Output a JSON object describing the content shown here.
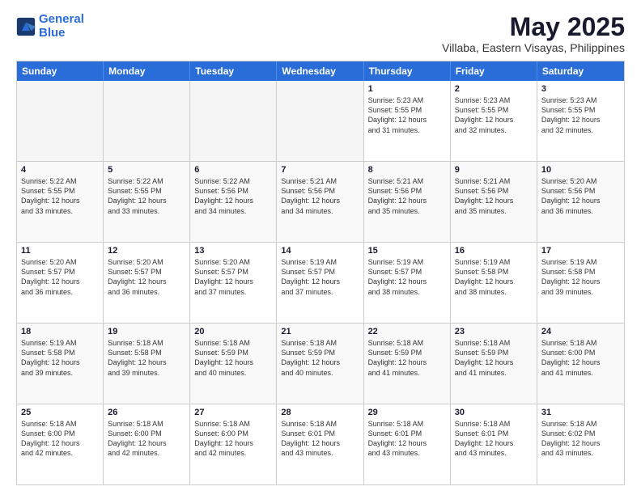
{
  "header": {
    "logo_line1": "General",
    "logo_line2": "Blue",
    "title": "May 2025",
    "subtitle": "Villaba, Eastern Visayas, Philippines"
  },
  "calendar": {
    "days_of_week": [
      "Sunday",
      "Monday",
      "Tuesday",
      "Wednesday",
      "Thursday",
      "Friday",
      "Saturday"
    ],
    "rows": [
      [
        {
          "day": "",
          "text": "",
          "empty": true
        },
        {
          "day": "",
          "text": "",
          "empty": true
        },
        {
          "day": "",
          "text": "",
          "empty": true
        },
        {
          "day": "",
          "text": "",
          "empty": true
        },
        {
          "day": "1",
          "text": "Sunrise: 5:23 AM\nSunset: 5:55 PM\nDaylight: 12 hours\nand 31 minutes.",
          "empty": false
        },
        {
          "day": "2",
          "text": "Sunrise: 5:23 AM\nSunset: 5:55 PM\nDaylight: 12 hours\nand 32 minutes.",
          "empty": false
        },
        {
          "day": "3",
          "text": "Sunrise: 5:23 AM\nSunset: 5:55 PM\nDaylight: 12 hours\nand 32 minutes.",
          "empty": false
        }
      ],
      [
        {
          "day": "4",
          "text": "Sunrise: 5:22 AM\nSunset: 5:55 PM\nDaylight: 12 hours\nand 33 minutes.",
          "empty": false
        },
        {
          "day": "5",
          "text": "Sunrise: 5:22 AM\nSunset: 5:55 PM\nDaylight: 12 hours\nand 33 minutes.",
          "empty": false
        },
        {
          "day": "6",
          "text": "Sunrise: 5:22 AM\nSunset: 5:56 PM\nDaylight: 12 hours\nand 34 minutes.",
          "empty": false
        },
        {
          "day": "7",
          "text": "Sunrise: 5:21 AM\nSunset: 5:56 PM\nDaylight: 12 hours\nand 34 minutes.",
          "empty": false
        },
        {
          "day": "8",
          "text": "Sunrise: 5:21 AM\nSunset: 5:56 PM\nDaylight: 12 hours\nand 35 minutes.",
          "empty": false
        },
        {
          "day": "9",
          "text": "Sunrise: 5:21 AM\nSunset: 5:56 PM\nDaylight: 12 hours\nand 35 minutes.",
          "empty": false
        },
        {
          "day": "10",
          "text": "Sunrise: 5:20 AM\nSunset: 5:56 PM\nDaylight: 12 hours\nand 36 minutes.",
          "empty": false
        }
      ],
      [
        {
          "day": "11",
          "text": "Sunrise: 5:20 AM\nSunset: 5:57 PM\nDaylight: 12 hours\nand 36 minutes.",
          "empty": false
        },
        {
          "day": "12",
          "text": "Sunrise: 5:20 AM\nSunset: 5:57 PM\nDaylight: 12 hours\nand 36 minutes.",
          "empty": false
        },
        {
          "day": "13",
          "text": "Sunrise: 5:20 AM\nSunset: 5:57 PM\nDaylight: 12 hours\nand 37 minutes.",
          "empty": false
        },
        {
          "day": "14",
          "text": "Sunrise: 5:19 AM\nSunset: 5:57 PM\nDaylight: 12 hours\nand 37 minutes.",
          "empty": false
        },
        {
          "day": "15",
          "text": "Sunrise: 5:19 AM\nSunset: 5:57 PM\nDaylight: 12 hours\nand 38 minutes.",
          "empty": false
        },
        {
          "day": "16",
          "text": "Sunrise: 5:19 AM\nSunset: 5:58 PM\nDaylight: 12 hours\nand 38 minutes.",
          "empty": false
        },
        {
          "day": "17",
          "text": "Sunrise: 5:19 AM\nSunset: 5:58 PM\nDaylight: 12 hours\nand 39 minutes.",
          "empty": false
        }
      ],
      [
        {
          "day": "18",
          "text": "Sunrise: 5:19 AM\nSunset: 5:58 PM\nDaylight: 12 hours\nand 39 minutes.",
          "empty": false
        },
        {
          "day": "19",
          "text": "Sunrise: 5:18 AM\nSunset: 5:58 PM\nDaylight: 12 hours\nand 39 minutes.",
          "empty": false
        },
        {
          "day": "20",
          "text": "Sunrise: 5:18 AM\nSunset: 5:59 PM\nDaylight: 12 hours\nand 40 minutes.",
          "empty": false
        },
        {
          "day": "21",
          "text": "Sunrise: 5:18 AM\nSunset: 5:59 PM\nDaylight: 12 hours\nand 40 minutes.",
          "empty": false
        },
        {
          "day": "22",
          "text": "Sunrise: 5:18 AM\nSunset: 5:59 PM\nDaylight: 12 hours\nand 41 minutes.",
          "empty": false
        },
        {
          "day": "23",
          "text": "Sunrise: 5:18 AM\nSunset: 5:59 PM\nDaylight: 12 hours\nand 41 minutes.",
          "empty": false
        },
        {
          "day": "24",
          "text": "Sunrise: 5:18 AM\nSunset: 6:00 PM\nDaylight: 12 hours\nand 41 minutes.",
          "empty": false
        }
      ],
      [
        {
          "day": "25",
          "text": "Sunrise: 5:18 AM\nSunset: 6:00 PM\nDaylight: 12 hours\nand 42 minutes.",
          "empty": false
        },
        {
          "day": "26",
          "text": "Sunrise: 5:18 AM\nSunset: 6:00 PM\nDaylight: 12 hours\nand 42 minutes.",
          "empty": false
        },
        {
          "day": "27",
          "text": "Sunrise: 5:18 AM\nSunset: 6:00 PM\nDaylight: 12 hours\nand 42 minutes.",
          "empty": false
        },
        {
          "day": "28",
          "text": "Sunrise: 5:18 AM\nSunset: 6:01 PM\nDaylight: 12 hours\nand 43 minutes.",
          "empty": false
        },
        {
          "day": "29",
          "text": "Sunrise: 5:18 AM\nSunset: 6:01 PM\nDaylight: 12 hours\nand 43 minutes.",
          "empty": false
        },
        {
          "day": "30",
          "text": "Sunrise: 5:18 AM\nSunset: 6:01 PM\nDaylight: 12 hours\nand 43 minutes.",
          "empty": false
        },
        {
          "day": "31",
          "text": "Sunrise: 5:18 AM\nSunset: 6:02 PM\nDaylight: 12 hours\nand 43 minutes.",
          "empty": false
        }
      ]
    ]
  }
}
